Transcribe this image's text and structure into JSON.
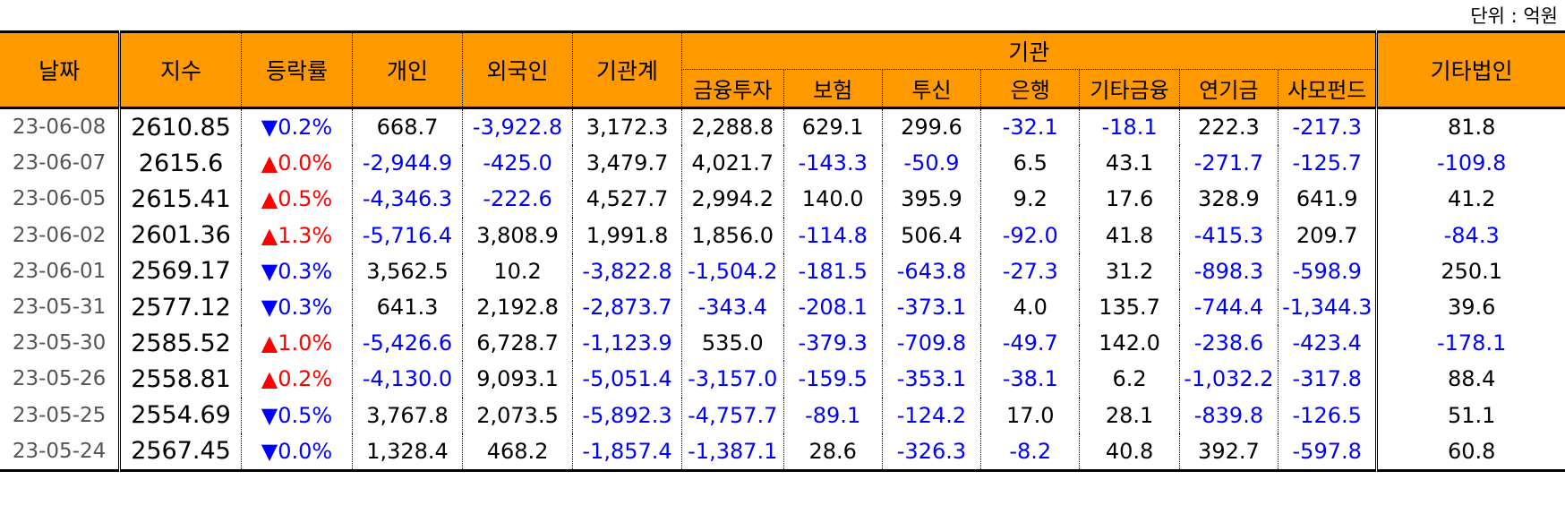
{
  "unit_label": "단위 : 억원",
  "headers": {
    "date": "날짜",
    "index": "지수",
    "change": "등락률",
    "individual": "개인",
    "foreign": "외국인",
    "institution_total": "기관계",
    "institution": "기관",
    "sub": [
      "금융투자",
      "보험",
      "투신",
      "은행",
      "기타금융",
      "연기금",
      "사모펀드"
    ],
    "other_corp": "기타법인"
  },
  "rows": [
    {
      "date": "23-06-08",
      "index": "2610.85",
      "dir": "down",
      "change": "0.2%",
      "vals": [
        "668.7",
        "-3,922.8",
        "3,172.3",
        "2,288.8",
        "629.1",
        "299.6",
        "-32.1",
        "-18.1",
        "222.3",
        "-217.3",
        "81.8"
      ]
    },
    {
      "date": "23-06-07",
      "index": "2615.6",
      "dir": "up",
      "change": "0.0%",
      "vals": [
        "-2,944.9",
        "-425.0",
        "3,479.7",
        "4,021.7",
        "-143.3",
        "-50.9",
        "6.5",
        "43.1",
        "-271.7",
        "-125.7",
        "-109.8"
      ]
    },
    {
      "date": "23-06-05",
      "index": "2615.41",
      "dir": "up",
      "change": "0.5%",
      "vals": [
        "-4,346.3",
        "-222.6",
        "4,527.7",
        "2,994.2",
        "140.0",
        "395.9",
        "9.2",
        "17.6",
        "328.9",
        "641.9",
        "41.2"
      ]
    },
    {
      "date": "23-06-02",
      "index": "2601.36",
      "dir": "up",
      "change": "1.3%",
      "vals": [
        "-5,716.4",
        "3,808.9",
        "1,991.8",
        "1,856.0",
        "-114.8",
        "506.4",
        "-92.0",
        "41.8",
        "-415.3",
        "209.7",
        "-84.3"
      ]
    },
    {
      "date": "23-06-01",
      "index": "2569.17",
      "dir": "down",
      "change": "0.3%",
      "vals": [
        "3,562.5",
        "10.2",
        "-3,822.8",
        "-1,504.2",
        "-181.5",
        "-643.8",
        "-27.3",
        "31.2",
        "-898.3",
        "-598.9",
        "250.1"
      ]
    },
    {
      "date": "23-05-31",
      "index": "2577.12",
      "dir": "down",
      "change": "0.3%",
      "vals": [
        "641.3",
        "2,192.8",
        "-2,873.7",
        "-343.4",
        "-208.1",
        "-373.1",
        "4.0",
        "135.7",
        "-744.4",
        "-1,344.3",
        "39.6"
      ]
    },
    {
      "date": "23-05-30",
      "index": "2585.52",
      "dir": "up",
      "change": "1.0%",
      "vals": [
        "-5,426.6",
        "6,728.7",
        "-1,123.9",
        "535.0",
        "-379.3",
        "-709.8",
        "-49.7",
        "142.0",
        "-238.6",
        "-423.4",
        "-178.1"
      ]
    },
    {
      "date": "23-05-26",
      "index": "2558.81",
      "dir": "up",
      "change": "0.2%",
      "vals": [
        "-4,130.0",
        "9,093.1",
        "-5,051.4",
        "-3,157.0",
        "-159.5",
        "-353.1",
        "-38.1",
        "6.2",
        "-1,032.2",
        "-317.8",
        "88.4"
      ]
    },
    {
      "date": "23-05-25",
      "index": "2554.69",
      "dir": "down",
      "change": "0.5%",
      "vals": [
        "3,767.8",
        "2,073.5",
        "-5,892.3",
        "-4,757.7",
        "-89.1",
        "-124.2",
        "17.0",
        "28.1",
        "-839.8",
        "-126.5",
        "51.1"
      ]
    },
    {
      "date": "23-05-24",
      "index": "2567.45",
      "dir": "down",
      "change": "0.0%",
      "vals": [
        "1,328.4",
        "468.2",
        "-1,857.4",
        "-1,387.1",
        "28.6",
        "-326.3",
        "-8.2",
        "40.8",
        "392.7",
        "-597.8",
        "60.8"
      ]
    }
  ],
  "colors": {
    "header_bg": "#ff9900",
    "negative": "#0000ff",
    "up": "#ff0000",
    "down": "#0000ff"
  },
  "symbols": {
    "up": "▲",
    "down": "▼"
  }
}
